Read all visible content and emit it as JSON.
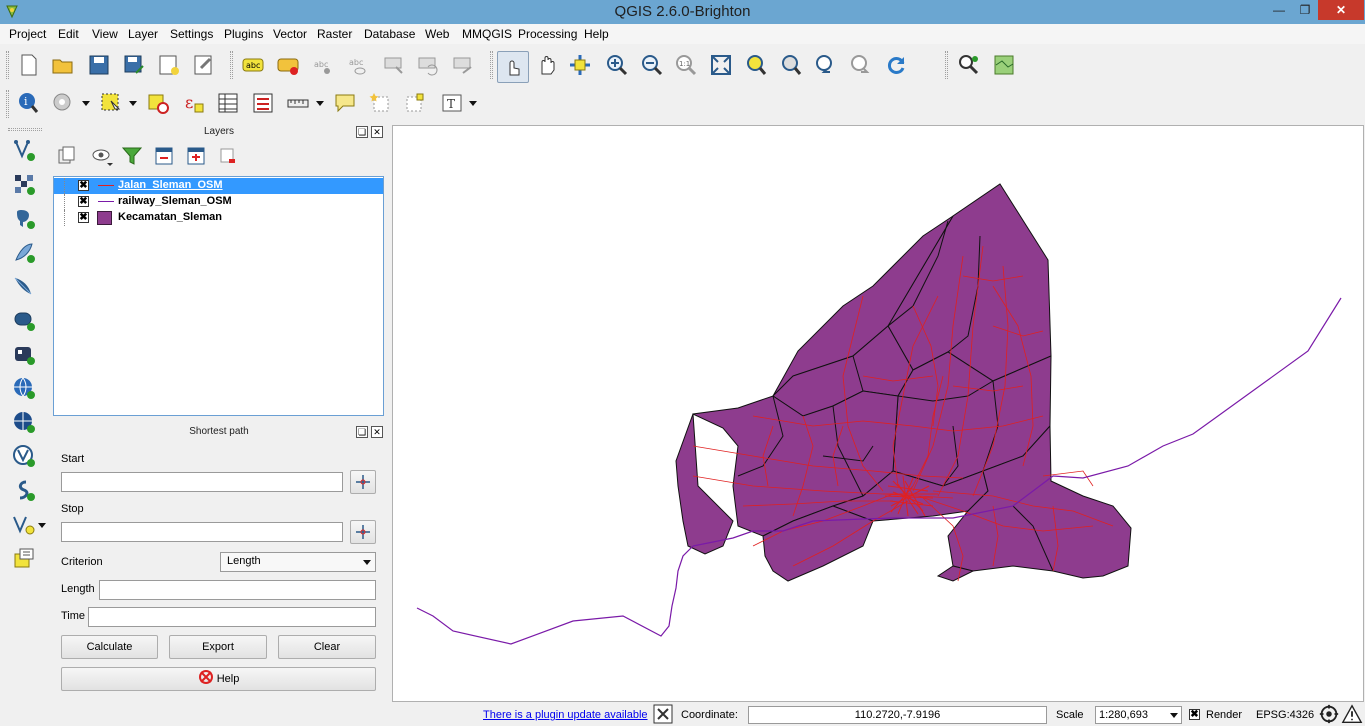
{
  "window": {
    "title": "QGIS 2.6.0-Brighton"
  },
  "menu": [
    "Project",
    "Edit",
    "View",
    "Layer",
    "Settings",
    "Plugins",
    "Vector",
    "Raster",
    "Database",
    "Web",
    "MMQGIS",
    "Processing",
    "Help"
  ],
  "layers_panel": {
    "title": "Layers",
    "layers": [
      {
        "name": "Jalan_Sleman_OSM",
        "checked": "✖",
        "symbol": "line",
        "color": "#e02020",
        "selected": true
      },
      {
        "name": "railway_Sleman_OSM",
        "checked": "✖",
        "symbol": "line",
        "color": "#7a1aa8",
        "selected": false
      },
      {
        "name": "Kecamatan_Sleman",
        "checked": "✖",
        "symbol": "fill",
        "color": "#8e3c8e",
        "selected": false
      }
    ]
  },
  "shortest_path": {
    "title": "Shortest path",
    "start_label": "Start",
    "stop_label": "Stop",
    "criterion_label": "Criterion",
    "criterion_value": "Length",
    "length_label": "Length",
    "time_label": "Time",
    "calculate_label": "Calculate",
    "export_label": "Export",
    "clear_label": "Clear",
    "help_label": "Help"
  },
  "status": {
    "plugin_update": "There is a plugin update available",
    "coordinate_label": "Coordinate:",
    "coordinate_value": "110.2720,-7.9196",
    "scale_label": "Scale",
    "scale_value": "1:280,693",
    "render_label": "Render",
    "render_checked": "✖",
    "crs": "EPSG:4326"
  },
  "colors": {
    "polygon_fill": "#8e3c8e",
    "road": "#e02020",
    "railway": "#7a1aa8",
    "titlebar": "#6ba6d1"
  }
}
